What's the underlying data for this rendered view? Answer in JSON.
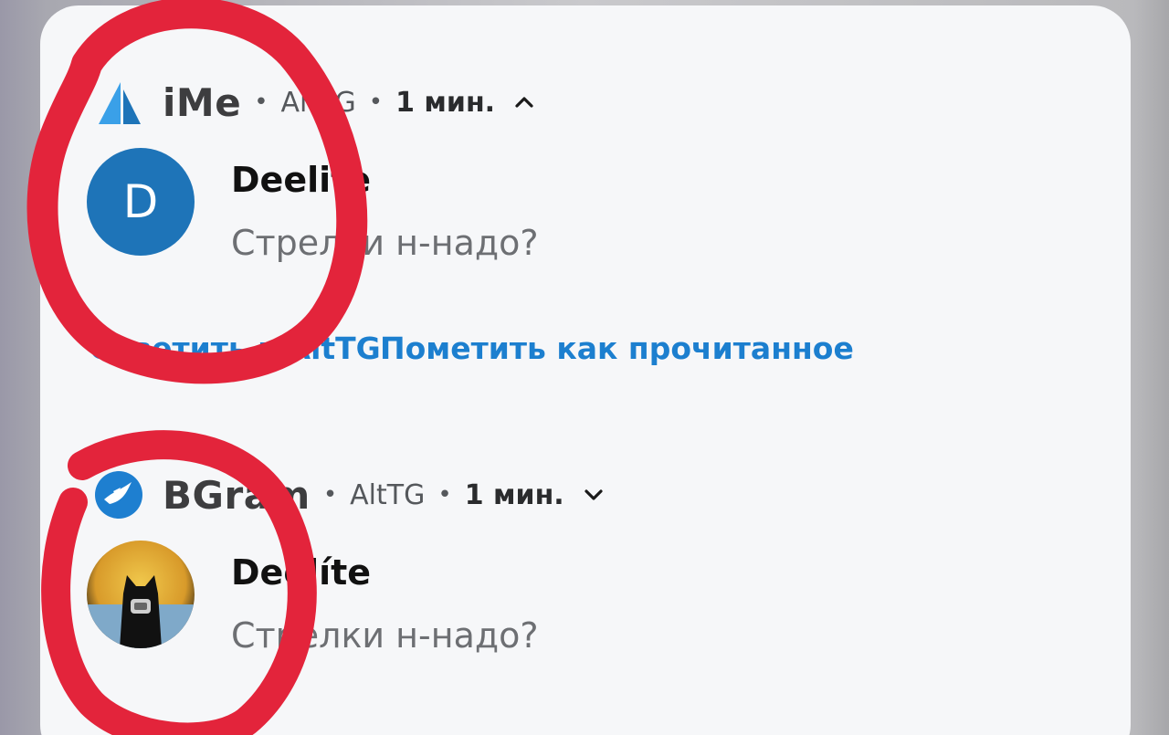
{
  "notifications": [
    {
      "app_icon": "ime-sail-icon",
      "app_name": "iMe",
      "account": "AltTG",
      "time": "1 мин.",
      "expand_icon": "chevron-up-icon",
      "sender": "Deelite",
      "avatar_letter": "D",
      "avatar_color": "#1e74b8",
      "message": "Стрелки н-надо?",
      "actions": [
        {
          "label": "Ответить в AltTG"
        },
        {
          "label": "Пометить как прочитанное"
        }
      ]
    },
    {
      "app_icon": "bgram-bird-icon",
      "app_name": "BGram",
      "account": "AltTG",
      "time": "1 мин.",
      "expand_icon": "chevron-down-icon",
      "sender": "Deelíte",
      "avatar_image": "cat-with-mask-moon-avatar",
      "message": "Стрелки н-надо?"
    }
  ],
  "colors": {
    "accent": "#1c7fcf",
    "annotation_red": "#e3243b",
    "card_bg": "#f6f7f9"
  }
}
